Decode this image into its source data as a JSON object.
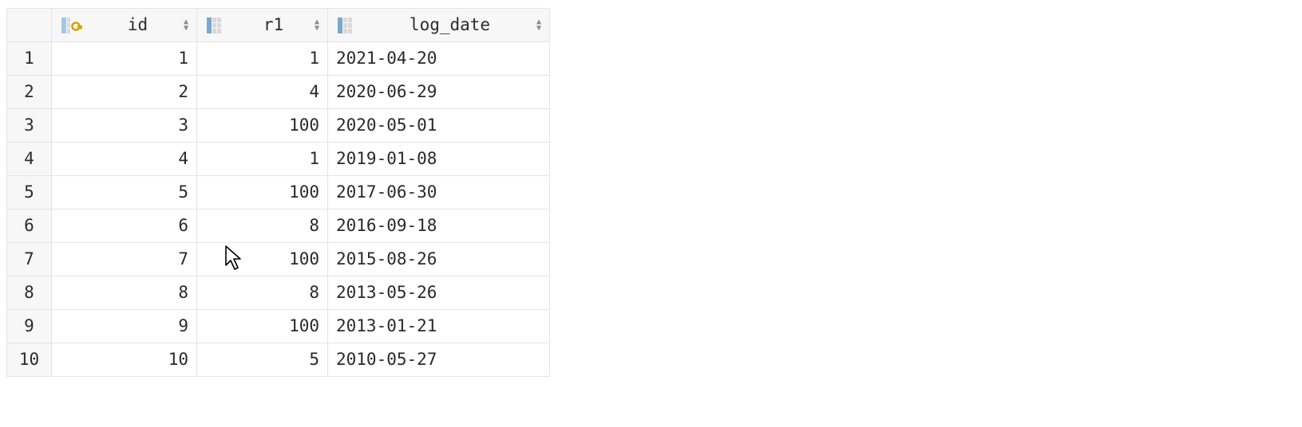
{
  "columns": {
    "id": {
      "label": "id"
    },
    "r1": {
      "label": "r1"
    },
    "log_date": {
      "label": "log_date"
    }
  },
  "rows": [
    {
      "n": "1",
      "id": "1",
      "r1": "1",
      "log_date": "2021-04-20"
    },
    {
      "n": "2",
      "id": "2",
      "r1": "4",
      "log_date": "2020-06-29"
    },
    {
      "n": "3",
      "id": "3",
      "r1": "100",
      "log_date": "2020-05-01"
    },
    {
      "n": "4",
      "id": "4",
      "r1": "1",
      "log_date": "2019-01-08"
    },
    {
      "n": "5",
      "id": "5",
      "r1": "100",
      "log_date": "2017-06-30"
    },
    {
      "n": "6",
      "id": "6",
      "r1": "8",
      "log_date": "2016-09-18"
    },
    {
      "n": "7",
      "id": "7",
      "r1": "100",
      "log_date": "2015-08-26"
    },
    {
      "n": "8",
      "id": "8",
      "r1": "8",
      "log_date": "2013-05-26"
    },
    {
      "n": "9",
      "id": "9",
      "r1": "100",
      "log_date": "2013-01-21"
    },
    {
      "n": "10",
      "id": "10",
      "r1": "5",
      "log_date": "2010-05-27"
    }
  ]
}
